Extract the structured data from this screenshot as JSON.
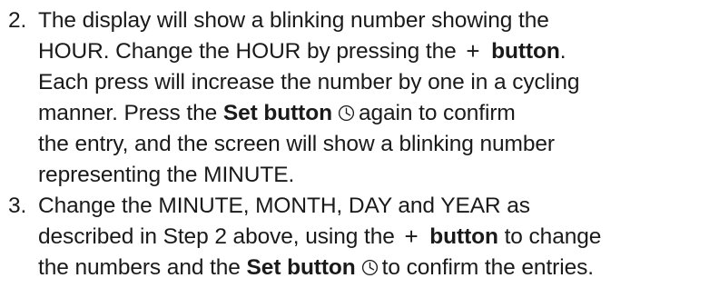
{
  "steps": [
    {
      "number": "2.",
      "lines": [
        {
          "text_a": "The display will show a blinking number showing the"
        },
        {
          "text_a": "HOUR. Change the HOUR by pressing the",
          "icon": "plus-icon",
          "bold": "button",
          "text_b": "."
        },
        {
          "text_a": "Each press will increase the number by one in a cycling"
        },
        {
          "text_a": "manner. Press the ",
          "bold": "Set button",
          "icon": "clock-icon",
          "text_b": "again to confirm"
        },
        {
          "text_a": "the entry, and the screen will show a blinking number"
        },
        {
          "text_a": "representing the MINUTE."
        }
      ]
    },
    {
      "number": "3.",
      "lines": [
        {
          "text_a": "Change the MINUTE, MONTH, DAY and YEAR as"
        },
        {
          "text_a": "described in Step 2 above, using the",
          "icon": "plus-icon",
          "bold": "button",
          "text_b": " to change"
        },
        {
          "text_a": "the numbers and the ",
          "bold": "Set button",
          "icon": "clock-icon",
          "text_b": "to confirm the entries."
        }
      ]
    }
  ],
  "icons": {
    "plus": "+",
    "clock": "clock-icon"
  }
}
